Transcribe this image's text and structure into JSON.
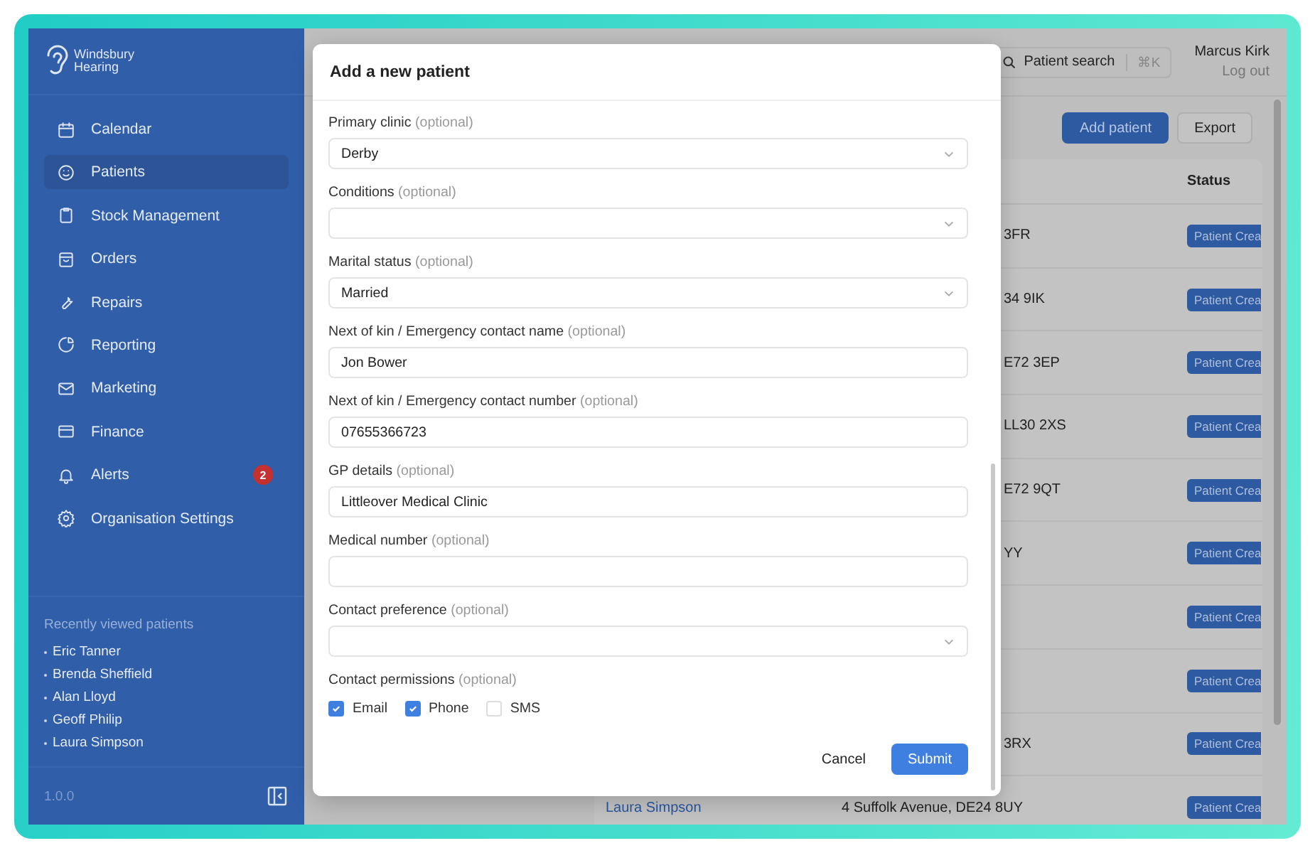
{
  "sidebar": {
    "logo": {
      "line_1": "Windsbury",
      "line_2": "Hearing"
    },
    "items": [
      {
        "label": "Calendar",
        "selected": false
      },
      {
        "label": "Patients",
        "selected": true
      },
      {
        "label": "Stock Management",
        "selected": false
      },
      {
        "label": "Orders",
        "selected": false
      },
      {
        "label": "Repairs",
        "selected": false
      },
      {
        "label": "Reporting",
        "selected": false
      },
      {
        "label": "Marketing",
        "selected": false
      },
      {
        "label": "Finance",
        "selected": false
      },
      {
        "label": "Alerts",
        "selected": false,
        "badge": "2"
      },
      {
        "label": "Organisation Settings",
        "selected": false
      }
    ],
    "recent": {
      "title": "Recently viewed patients",
      "patients": [
        "Eric Tanner",
        "Brenda Sheffield",
        "Alan Lloyd",
        "Geoff Philip",
        "Laura Simpson"
      ]
    },
    "version": "1.0.0"
  },
  "topbar": {
    "search": {
      "placeholder": "Patient search",
      "shortcut": "⌘K"
    },
    "user": {
      "name": "Marcus Kirk",
      "logout": "Log out"
    }
  },
  "actions": [
    "Add patient",
    "Export"
  ],
  "table": {
    "columns": [
      "Status"
    ],
    "rows": [
      {
        "address": "3FR",
        "kind": "partial",
        "status": "Patient Crea"
      },
      {
        "address": "34 9IK",
        "kind": "partial",
        "status": "Patient Crea"
      },
      {
        "address": "E72 3EP",
        "kind": "partial",
        "status": "Patient Crea"
      },
      {
        "address": "LL30 2XS",
        "kind": "partial",
        "status": "Patient Crea"
      },
      {
        "address": "E72 9QT",
        "kind": "partial",
        "status": "Patient Crea"
      },
      {
        "address": "YY",
        "kind": "partial",
        "status": "Patient Crea"
      },
      {
        "status": "Patient Crea"
      },
      {
        "status": "Patient Crea"
      },
      {
        "address": "3RX",
        "kind": "partial",
        "status": "Patient Crea"
      },
      {
        "name": "Laura Simpson",
        "address": "4 Suffolk Avenue, DE24 8UY",
        "kind": "full",
        "status": "Patient Crea"
      }
    ]
  },
  "modal": {
    "title": "Add a new patient",
    "fields": [
      {
        "label": "Primary clinic",
        "hint": "(optional)",
        "kind": "select",
        "value": "Derby"
      },
      {
        "label": "Conditions",
        "hint": "(optional)",
        "kind": "select"
      },
      {
        "label": "Marital status",
        "hint": "(optional)",
        "kind": "select",
        "value": "Married"
      },
      {
        "label": "Next of kin / Emergency contact name",
        "hint": "(optional)",
        "kind": "text",
        "value": "Jon Bower"
      },
      {
        "label": "Next of kin / Emergency contact number",
        "hint": "(optional)",
        "kind": "text",
        "value": "07655366723"
      },
      {
        "label": "GP details",
        "hint": "(optional)",
        "kind": "text",
        "value": "Littleover Medical Clinic"
      },
      {
        "label": "Medical number",
        "hint": "(optional)",
        "kind": "text"
      },
      {
        "label": "Contact preference",
        "hint": "(optional)",
        "kind": "select"
      },
      {
        "label": "Contact permissions",
        "hint": "(optional)",
        "kind": "checkboxes",
        "options": [
          {
            "label": "Email",
            "checked": true
          },
          {
            "label": "Phone",
            "checked": true
          },
          {
            "label": "SMS",
            "checked": false
          }
        ]
      }
    ],
    "buttons": {
      "cancel": "Cancel",
      "submit": "Submit"
    }
  }
}
